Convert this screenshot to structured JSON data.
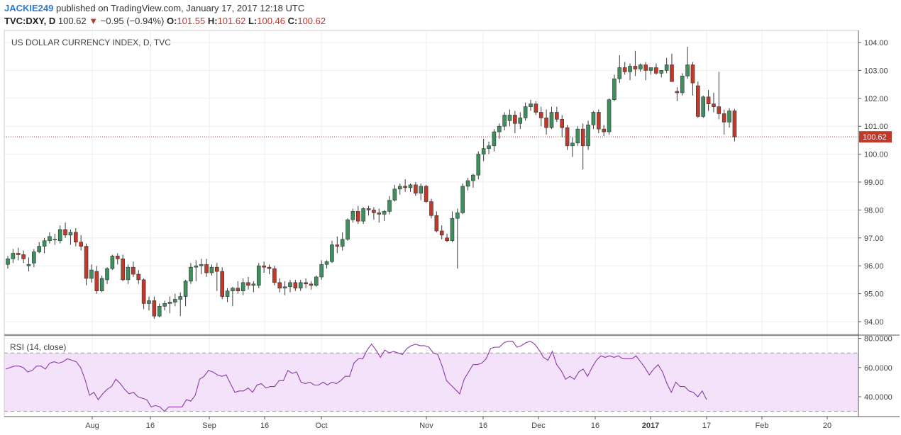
{
  "header": {
    "author": "JACKIE249",
    "published": " published on TradingView.com, January 17, 2017 12:18 UTC",
    "symbol": "TVC:DXY, D",
    "last": "100.62",
    "arrow": "▼",
    "change": "−0.95 (−0.94%)",
    "o_label": "O:",
    "o_value": "101.55",
    "h_label": "H:",
    "h_value": "101.62",
    "l_label": "L:",
    "l_value": "100.46",
    "c_label": "C:",
    "c_value": "100.62"
  },
  "colors": {
    "up": "#3e8f5e",
    "down": "#c0392b",
    "last_price": "#c0392b",
    "rsi_line": "#8e3aa8",
    "rsi_band": "#f3e2fa"
  },
  "chart_data": [
    {
      "type": "candlestick",
      "title": "US DOLLAR CURRENCY INDEX, D, TVC",
      "last_price_label": "100.62",
      "ylim": [
        93.7,
        104.3
      ],
      "grid": true,
      "y_ticks": [
        "94.00",
        "95.00",
        "96.00",
        "97.00",
        "98.00",
        "99.00",
        "100.00",
        "101.00",
        "102.00",
        "103.00",
        "104.00"
      ],
      "x_ticks": [
        "Aug",
        "16",
        "Sep",
        "16",
        "Oct",
        "Nov",
        "16",
        "Dec",
        "16",
        "2017",
        "17",
        "Feb",
        "20"
      ],
      "ohlc": [
        [
          96.05,
          96.35,
          95.9,
          96.25
        ],
        [
          96.25,
          96.6,
          96.1,
          96.45
        ],
        [
          96.45,
          96.65,
          96.2,
          96.4
        ],
        [
          96.4,
          96.55,
          96.1,
          96.25
        ],
        [
          96.0,
          96.3,
          95.8,
          96.05
        ],
        [
          96.1,
          96.6,
          95.95,
          96.5
        ],
        [
          96.5,
          96.85,
          96.45,
          96.7
        ],
        [
          96.7,
          97.0,
          96.45,
          96.9
        ],
        [
          96.9,
          97.2,
          96.8,
          97.05
        ],
        [
          96.95,
          97.15,
          96.75,
          96.95
        ],
        [
          96.9,
          97.45,
          96.8,
          97.3
        ],
        [
          97.3,
          97.55,
          97.0,
          97.1
        ],
        [
          97.1,
          97.3,
          96.75,
          97.2
        ],
        [
          97.2,
          97.35,
          96.7,
          96.85
        ],
        [
          96.85,
          97.1,
          96.55,
          96.7
        ],
        [
          96.7,
          96.8,
          95.3,
          95.55
        ],
        [
          95.55,
          96.05,
          95.4,
          95.85
        ],
        [
          95.8,
          96.0,
          95.0,
          95.1
        ],
        [
          95.1,
          95.65,
          95.05,
          95.55
        ],
        [
          95.5,
          95.95,
          95.35,
          95.9
        ],
        [
          95.9,
          96.4,
          95.85,
          96.35
        ],
        [
          96.35,
          96.45,
          96.05,
          96.25
        ],
        [
          96.25,
          96.4,
          95.45,
          95.5
        ],
        [
          95.5,
          96.05,
          95.35,
          95.95
        ],
        [
          95.95,
          96.15,
          95.6,
          95.7
        ],
        [
          95.7,
          95.85,
          95.35,
          95.5
        ],
        [
          95.5,
          95.55,
          94.45,
          94.65
        ],
        [
          94.65,
          94.9,
          94.4,
          94.75
        ],
        [
          94.75,
          94.9,
          94.1,
          94.2
        ],
        [
          94.2,
          94.65,
          94.15,
          94.55
        ],
        [
          94.55,
          94.75,
          94.4,
          94.65
        ],
        [
          94.65,
          94.9,
          94.3,
          94.7
        ],
        [
          94.7,
          95.0,
          94.55,
          94.8
        ],
        [
          94.8,
          95.05,
          94.2,
          94.9
        ],
        [
          94.9,
          95.5,
          94.55,
          95.45
        ],
        [
          95.45,
          96.1,
          95.35,
          95.95
        ],
        [
          95.95,
          96.2,
          95.45,
          96.0
        ],
        [
          96.0,
          96.25,
          95.7,
          96.05
        ],
        [
          96.05,
          96.25,
          95.6,
          95.75
        ],
        [
          95.75,
          96.05,
          95.65,
          95.95
        ],
        [
          95.95,
          96.1,
          95.1,
          95.8
        ],
        [
          95.8,
          95.95,
          94.8,
          94.9
        ],
        [
          94.9,
          95.2,
          94.7,
          95.1
        ],
        [
          95.1,
          95.25,
          94.55,
          95.2
        ],
        [
          95.2,
          95.45,
          95.0,
          95.1
        ],
        [
          95.1,
          95.55,
          94.95,
          95.4
        ],
        [
          95.4,
          95.6,
          95.15,
          95.3
        ],
        [
          95.3,
          95.45,
          95.05,
          95.35
        ],
        [
          95.3,
          96.1,
          95.2,
          96.0
        ],
        [
          96.0,
          96.15,
          95.75,
          95.95
        ],
        [
          95.95,
          96.05,
          95.7,
          95.9
        ],
        [
          95.9,
          96.0,
          95.3,
          95.4
        ],
        [
          95.4,
          95.55,
          95.05,
          95.2
        ],
        [
          95.2,
          95.45,
          94.95,
          95.25
        ],
        [
          95.25,
          95.5,
          95.05,
          95.4
        ],
        [
          95.4,
          95.5,
          95.1,
          95.2
        ],
        [
          95.2,
          95.5,
          95.1,
          95.4
        ],
        [
          95.4,
          95.55,
          95.2,
          95.35
        ],
        [
          95.35,
          95.45,
          95.15,
          95.3
        ],
        [
          95.3,
          95.65,
          95.25,
          95.6
        ],
        [
          95.6,
          96.2,
          95.5,
          96.05
        ],
        [
          96.05,
          96.2,
          95.9,
          96.15
        ],
        [
          96.15,
          96.9,
          96.1,
          96.75
        ],
        [
          96.75,
          97.05,
          96.45,
          96.7
        ],
        [
          96.7,
          97.2,
          96.55,
          96.95
        ],
        [
          96.95,
          97.7,
          96.9,
          97.65
        ],
        [
          97.65,
          98.05,
          97.55,
          97.95
        ],
        [
          97.95,
          98.15,
          97.5,
          97.6
        ],
        [
          97.6,
          98.1,
          97.5,
          98.05
        ],
        [
          98.05,
          98.15,
          97.8,
          98.0
        ],
        [
          98.0,
          98.1,
          97.65,
          97.9
        ],
        [
          97.9,
          98.05,
          97.55,
          97.85
        ],
        [
          97.85,
          98.0,
          97.6,
          97.95
        ],
        [
          97.95,
          98.5,
          97.85,
          98.35
        ],
        [
          98.35,
          98.9,
          98.3,
          98.75
        ],
        [
          98.75,
          98.95,
          98.55,
          98.85
        ],
        [
          98.85,
          99.1,
          98.65,
          98.8
        ],
        [
          98.8,
          98.95,
          98.65,
          98.9
        ],
        [
          98.9,
          99.0,
          98.5,
          98.6
        ],
        [
          98.6,
          98.95,
          98.35,
          98.85
        ],
        [
          98.85,
          98.9,
          98.25,
          98.3
        ],
        [
          98.3,
          98.4,
          97.7,
          97.8
        ],
        [
          97.8,
          97.95,
          97.2,
          97.25
        ],
        [
          97.25,
          97.45,
          96.95,
          97.1
        ],
        [
          97.0,
          97.15,
          96.85,
          96.9
        ],
        [
          96.9,
          97.95,
          96.85,
          97.7
        ],
        [
          97.7,
          98.05,
          95.9,
          97.9
        ],
        [
          97.9,
          98.95,
          97.85,
          98.85
        ],
        [
          98.85,
          99.15,
          98.7,
          99.05
        ],
        [
          99.05,
          99.3,
          98.8,
          99.25
        ],
        [
          99.25,
          100.1,
          99.1,
          100.0
        ],
        [
          100.0,
          100.55,
          99.75,
          100.2
        ],
        [
          100.2,
          100.45,
          100.0,
          100.3
        ],
        [
          100.3,
          100.9,
          100.1,
          100.8
        ],
        [
          100.8,
          101.1,
          100.55,
          101.0
        ],
        [
          101.0,
          101.5,
          100.85,
          101.4
        ],
        [
          101.2,
          101.6,
          101.0,
          101.4
        ],
        [
          101.4,
          101.55,
          100.75,
          101.1
        ],
        [
          101.1,
          101.5,
          100.9,
          101.3
        ],
        [
          101.3,
          101.85,
          101.2,
          101.7
        ],
        [
          101.7,
          101.95,
          101.55,
          101.8
        ],
        [
          101.8,
          101.9,
          101.4,
          101.5
        ],
        [
          101.5,
          101.7,
          101.0,
          101.3
        ],
        [
          101.3,
          101.6,
          100.7,
          100.95
        ],
        [
          100.95,
          101.7,
          100.9,
          101.5
        ],
        [
          101.5,
          101.7,
          101.15,
          101.25
        ],
        [
          101.25,
          101.4,
          100.6,
          100.95
        ],
        [
          100.95,
          101.05,
          100.15,
          100.3
        ],
        [
          100.3,
          100.6,
          99.9,
          100.4
        ],
        [
          100.4,
          101.0,
          100.3,
          100.9
        ],
        [
          100.9,
          101.1,
          99.45,
          100.3
        ],
        [
          100.3,
          101.2,
          100.15,
          101.05
        ],
        [
          101.05,
          101.55,
          100.9,
          101.5
        ],
        [
          101.5,
          101.6,
          100.75,
          100.9
        ],
        [
          100.9,
          101.05,
          100.65,
          100.8
        ],
        [
          100.8,
          102.0,
          100.7,
          101.95
        ],
        [
          101.95,
          102.85,
          101.9,
          102.7
        ],
        [
          102.7,
          103.55,
          102.55,
          103.1
        ],
        [
          103.1,
          103.3,
          102.85,
          102.95
        ],
        [
          102.95,
          103.25,
          102.65,
          103.15
        ],
        [
          103.15,
          103.7,
          102.8,
          103.05
        ],
        [
          103.05,
          103.25,
          102.95,
          103.2
        ],
        [
          103.2,
          103.3,
          102.65,
          103.0
        ],
        [
          103.0,
          103.1,
          102.85,
          103.1
        ],
        [
          103.1,
          103.25,
          102.85,
          102.9
        ],
        [
          102.9,
          103.0,
          102.75,
          103.0
        ],
        [
          103.0,
          103.45,
          102.9,
          103.2
        ],
        [
          103.2,
          103.6,
          102.6,
          102.6
        ],
        [
          102.25,
          102.4,
          101.9,
          102.2
        ],
        [
          102.2,
          102.9,
          102.1,
          102.8
        ],
        [
          102.8,
          103.85,
          102.7,
          103.2
        ],
        [
          103.2,
          103.3,
          102.1,
          102.55
        ],
        [
          102.45,
          102.6,
          101.3,
          101.35
        ],
        [
          101.35,
          102.1,
          101.3,
          102.05
        ],
        [
          102.05,
          102.3,
          101.55,
          101.8
        ],
        [
          101.8,
          102.2,
          101.5,
          101.7
        ],
        [
          101.7,
          102.95,
          101.25,
          101.45
        ],
        [
          101.45,
          101.6,
          100.7,
          101.15
        ],
        [
          101.15,
          101.65,
          100.95,
          101.55
        ],
        [
          101.55,
          101.62,
          100.46,
          100.62
        ]
      ],
      "ohlc_columns": [
        "open",
        "high",
        "low",
        "close"
      ]
    },
    {
      "type": "line",
      "title": "RSI (14, close)",
      "ylim": [
        30,
        75
      ],
      "y_ticks": [
        "40.0000",
        "60.0000",
        "80.0000"
      ],
      "bands": [
        30,
        70
      ],
      "values": [
        59,
        60,
        61,
        61,
        60,
        57,
        58,
        61,
        61,
        59,
        63,
        64,
        63,
        64,
        66,
        65,
        64,
        60,
        52,
        41,
        43,
        38,
        42,
        45,
        47,
        52,
        49,
        45,
        42,
        43,
        40,
        39,
        38,
        33,
        34,
        33,
        30,
        33,
        33,
        33,
        33,
        38,
        37,
        41,
        52,
        54,
        58,
        57,
        55,
        54,
        55,
        49,
        43,
        44,
        44,
        46,
        43,
        48,
        49,
        46,
        47,
        47,
        51,
        51,
        58,
        56,
        57,
        50,
        49,
        50,
        48,
        48,
        50,
        48,
        50,
        49,
        51,
        54,
        54,
        63,
        66,
        66,
        72,
        76,
        72,
        67,
        72,
        70,
        71,
        70,
        69,
        73,
        75,
        76,
        75,
        75,
        74,
        70,
        69,
        61,
        51,
        48,
        45,
        42,
        52,
        57,
        62,
        62,
        63,
        66,
        73,
        74,
        74,
        77,
        78,
        78,
        74,
        75,
        77,
        78,
        76,
        72,
        67,
        65,
        71,
        62,
        58,
        52,
        54,
        52,
        57,
        59,
        54,
        60,
        65,
        68,
        67,
        68,
        67,
        68,
        66,
        66,
        66,
        68,
        64,
        60,
        55,
        59,
        62,
        57,
        49,
        43,
        50,
        47,
        47,
        44,
        43,
        40,
        44,
        38
      ]
    }
  ]
}
